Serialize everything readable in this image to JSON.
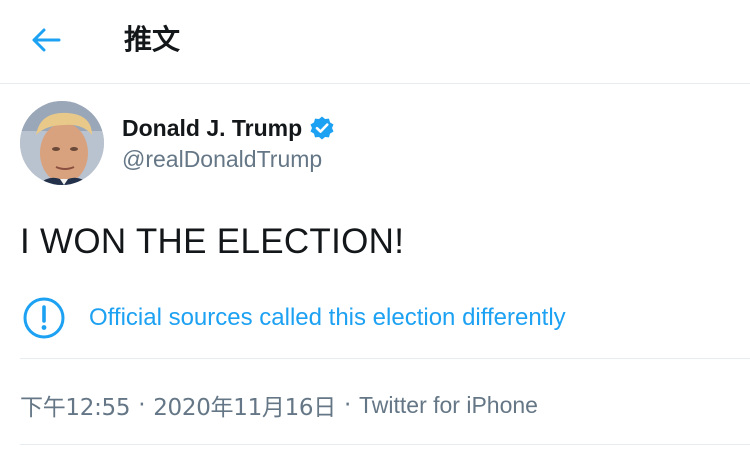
{
  "header": {
    "back_icon": "arrow-left-icon",
    "title": "推文"
  },
  "author": {
    "name": "Donald J. Trump",
    "handle": "@realDonaldTrump",
    "verified_icon": "verified-badge-icon"
  },
  "tweet": {
    "text": "I WON THE ELECTION!"
  },
  "notice": {
    "icon": "exclamation-circle-icon",
    "text": "Official sources called this election differently"
  },
  "meta": {
    "time": "下午12:55",
    "separator": "·",
    "date": "2020年11月16日",
    "source": "Twitter for iPhone"
  },
  "colors": {
    "accent": "#1da1f2",
    "text_primary": "#14171a",
    "text_secondary": "#657786",
    "divider": "#e6ecf0"
  }
}
